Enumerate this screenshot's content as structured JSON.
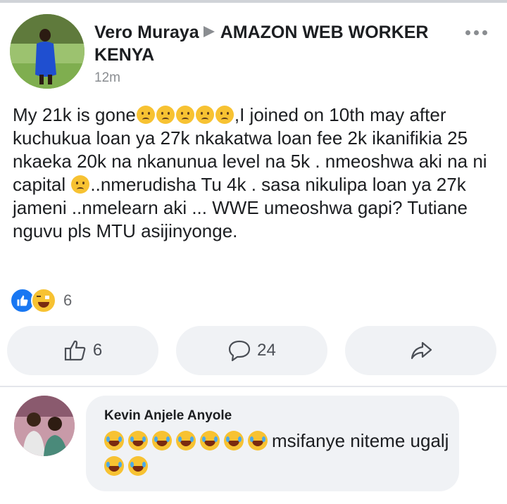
{
  "post": {
    "author": "Vero Muraya",
    "group": "AMAZON WEB WORKER KENYA",
    "time": "12m",
    "text_1": "My 21k is gone",
    "text_2": ",I joined on 10th may after kuchukua loan ya 27k nkakatwa loan fee 2k ikanifikia 25 nkaeka 20k na nkanunua level na 5k . nmeoshwa aki na ni capital ",
    "text_3": "..nmerudisha Tu 4k . sasa nikulipa loan ya 27k jameni ..nmelearn aki ... WWE umeoshwa gapi? Tutiane nguvu pls MTU asijinyonge."
  },
  "reactions": {
    "count": "6"
  },
  "actions": {
    "like_count": "6",
    "comment_count": "24"
  },
  "comment": {
    "author": "Kevin Anjele Anyole",
    "text_1": "msifanye niteme ugalj"
  },
  "icons": {
    "like": "thumbs-up-icon",
    "comment": "comment-bubble-icon",
    "share": "share-arrow-icon",
    "more": "more-dots-icon"
  },
  "colors": {
    "like_blue": "#1877f2",
    "pill_bg": "#f0f2f5",
    "muted": "#65676b"
  }
}
